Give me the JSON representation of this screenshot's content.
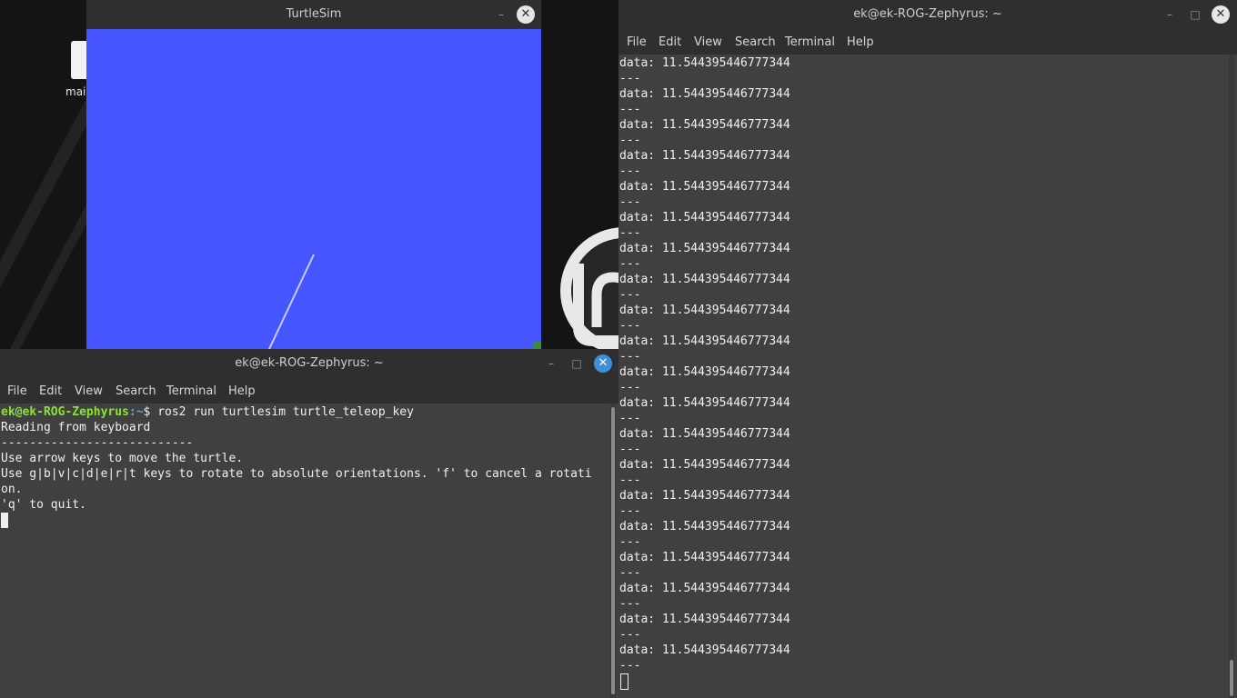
{
  "colors": {
    "turtle_bg": "#4556ff",
    "terminal_bg": "#404040",
    "titlebar_bg": "#2f2f2f",
    "prompt_user": "#8ae234",
    "prompt_path": "#729fcf",
    "close_active": "#3f8fd8"
  },
  "desktop": {
    "icon_label": "mai",
    "icon": "file-icon"
  },
  "turtlesim": {
    "title": "TurtleSim",
    "minimize": "–",
    "close": "✕"
  },
  "right_terminal": {
    "title": "ek@ek-ROG-Zephyrus: ~",
    "minimize": "–",
    "maximize": "□",
    "close": "✕",
    "menu": [
      "File",
      "Edit",
      "View",
      "Search",
      "Terminal",
      "Help"
    ],
    "lines": [
      "data: 11.544395446777344",
      "---",
      "data: 11.544395446777344",
      "---",
      "data: 11.544395446777344",
      "---",
      "data: 11.544395446777344",
      "---",
      "data: 11.544395446777344",
      "---",
      "data: 11.544395446777344",
      "---",
      "data: 11.544395446777344",
      "---",
      "data: 11.544395446777344",
      "---",
      "data: 11.544395446777344",
      "---",
      "data: 11.544395446777344",
      "---",
      "data: 11.544395446777344",
      "---",
      "data: 11.544395446777344",
      "---",
      "data: 11.544395446777344",
      "---",
      "data: 11.544395446777344",
      "---",
      "data: 11.544395446777344",
      "---",
      "data: 11.544395446777344",
      "---",
      "data: 11.544395446777344",
      "---",
      "data: 11.544395446777344",
      "---",
      "data: 11.544395446777344",
      "---",
      "data: 11.544395446777344",
      "---"
    ]
  },
  "left_terminal": {
    "title": "ek@ek-ROG-Zephyrus: ~",
    "minimize": "–",
    "maximize": "□",
    "close": "✕",
    "menu": [
      "File",
      "Edit",
      "View",
      "Search",
      "Terminal",
      "Help"
    ],
    "prompt_user": "ek@ek-ROG-Zephyrus",
    "prompt_path": ":~",
    "prompt_symbol": "$ ",
    "command": "ros2 run turtlesim turtle_teleop_key",
    "lines": [
      "Reading from keyboard",
      "---------------------------",
      "Use arrow keys to move the turtle.",
      "Use g|b|v|c|d|e|r|t keys to rotate to absolute orientations. 'f' to cancel a rotati",
      "on.",
      "'q' to quit."
    ]
  }
}
